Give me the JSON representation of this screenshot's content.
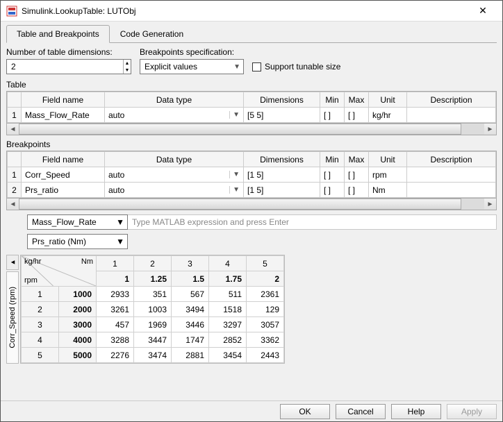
{
  "window": {
    "title": "Simulink.LookupTable: LUTObj"
  },
  "tabs": {
    "t0": "Table and Breakpoints",
    "t1": "Code Generation"
  },
  "controls": {
    "numdim_label": "Number of table dimensions:",
    "numdim_value": "2",
    "bpspec_label": "Breakpoints specification:",
    "bpspec_value": "Explicit values",
    "tunable_label": "Support tunable size"
  },
  "sections": {
    "table": "Table",
    "bp": "Breakpoints"
  },
  "headers": {
    "field": "Field name",
    "datatype": "Data type",
    "dims": "Dimensions",
    "min": "Min",
    "max": "Max",
    "unit": "Unit",
    "desc": "Description"
  },
  "tableRows": [
    {
      "idx": "1",
      "name": "Mass_Flow_Rate",
      "dtype": "auto",
      "dims": "[5 5]",
      "min": "[ ]",
      "max": "[ ]",
      "unit": "kg/hr",
      "desc": ""
    }
  ],
  "bpRows": [
    {
      "idx": "1",
      "name": "Corr_Speed",
      "dtype": "auto",
      "dims": "[1 5]",
      "min": "[ ]",
      "max": "[ ]",
      "unit": "rpm",
      "desc": ""
    },
    {
      "idx": "2",
      "name": "Prs_ratio",
      "dtype": "auto",
      "dims": "[1 5]",
      "min": "[ ]",
      "max": "[ ]",
      "unit": "Nm",
      "desc": ""
    }
  ],
  "expr": {
    "tableSel": "Mass_Flow_Rate",
    "placeholder": "Type MATLAB expression and press Enter",
    "bpSel": "Prs_ratio (Nm)"
  },
  "vtab": {
    "label": "Corr_Speed (rpm)"
  },
  "chart_data": {
    "type": "table",
    "row_unit": "rpm",
    "col_top_left": "kg/hr",
    "col_top_right": "Nm",
    "col_bp_values": [
      "1",
      "1.25",
      "1.5",
      "1.75",
      "2"
    ],
    "col_indices": [
      "1",
      "2",
      "3",
      "4",
      "5"
    ],
    "row_indices": [
      "1",
      "2",
      "3",
      "4",
      "5"
    ],
    "row_bp_values": [
      "1000",
      "2000",
      "3000",
      "4000",
      "5000"
    ],
    "cells": [
      [
        "2933",
        "351",
        "567",
        "511",
        "2361"
      ],
      [
        "3261",
        "1003",
        "3494",
        "1518",
        "129"
      ],
      [
        "457",
        "1969",
        "3446",
        "3297",
        "3057"
      ],
      [
        "3288",
        "3447",
        "1747",
        "2852",
        "3362"
      ],
      [
        "2276",
        "3474",
        "2881",
        "3454",
        "2443"
      ]
    ]
  },
  "buttons": {
    "ok": "OK",
    "cancel": "Cancel",
    "help": "Help",
    "apply": "Apply"
  }
}
